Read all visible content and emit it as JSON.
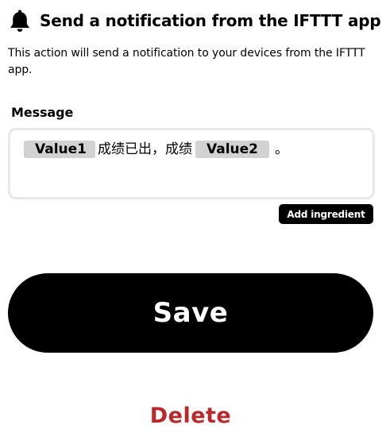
{
  "header": {
    "icon": "bell-icon",
    "title": "Send a notification from the IFTTT app"
  },
  "description": "This action will send a notification to your devices from the IFTTT app.",
  "message": {
    "label": "Message",
    "ingredient_1": "Value1",
    "text_middle": "成绩已出，成绩",
    "ingredient_2": "Value2",
    "text_end": "。"
  },
  "actions": {
    "add_ingredient_label": "Add ingredient",
    "save_label": "Save",
    "delete_label": "Delete"
  },
  "colors": {
    "primary": "#000000",
    "delete": "#b8292c",
    "ingredient_bg": "#d2d2d2",
    "field_border": "#e8e8e8"
  }
}
